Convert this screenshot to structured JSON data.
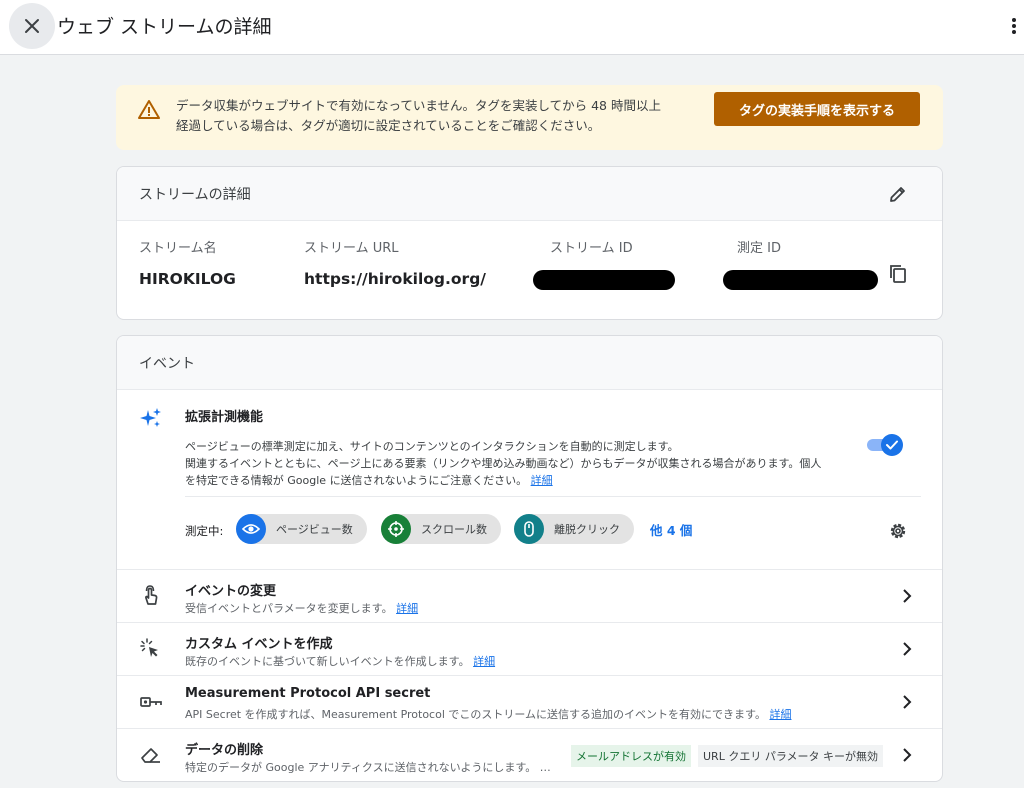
{
  "header": {
    "title": "ウェブ ストリームの詳細",
    "close_icon": "close-icon",
    "more_icon": "more-vert-icon"
  },
  "banner": {
    "icon": "warning-icon",
    "text_line1": "データ収集がウェブサイトで有効になっていません。タグを実装してから 48 時間以上",
    "text_line2": "経過している場合は、タグが適切に設定されていることをご確認ください。",
    "button_label": "タグの実装手順を表示する",
    "bg_color": "#fef7e0",
    "button_color": "#b06000"
  },
  "stream_details": {
    "title": "ストリームの詳細",
    "edit_icon": "edit-pencil-icon",
    "copy_icon": "copy-icon",
    "columns": [
      {
        "label": "ストリーム名",
        "value": "HIROKILOG"
      },
      {
        "label": "ストリーム URL",
        "value": "https://hirokilog.org/"
      },
      {
        "label": "ストリーム ID",
        "value": ""
      },
      {
        "label": "測定 ID",
        "value": ""
      }
    ]
  },
  "events": {
    "title": "イベント",
    "enhanced": {
      "icon": "sparkle-icon",
      "title": "拡張計測機能",
      "desc_line1": "ページビューの標準測定に加え、サイトのコンテンツとのインタラクションを自動的に測定します。",
      "desc_line2": "関連するイベントとともに、ページ上にある要素（リンクや埋め込み動画など）からもデータが収集される場合があります。個人",
      "desc_line3": "を特定できる情報が Google に送信されないようにご注意ください。",
      "link": "詳細",
      "toggle_on": true,
      "measuring_label": "測定中:",
      "chips": [
        {
          "label": "ページビュー数",
          "icon": "eye-icon",
          "color": "#1a73e8"
        },
        {
          "label": "スクロール数",
          "icon": "scroll-crosshair-icon",
          "color": "#188038"
        },
        {
          "label": "離脱クリック",
          "icon": "mouse-icon",
          "color": "#12808a"
        }
      ],
      "others": "他 4 個",
      "settings_icon": "gear-icon"
    },
    "rows": [
      {
        "icon": "touch-hand-icon",
        "title": "イベントの変更",
        "subtitle": "受信イベントとパラメータを変更します。",
        "link": "詳細"
      },
      {
        "icon": "click-sparkle-icon",
        "title": "カスタム イベントを作成",
        "subtitle": "既存のイベントに基づいて新しいイベントを作成します。",
        "link": "詳細"
      },
      {
        "icon": "key-icon",
        "title": "Measurement Protocol API secret",
        "subtitle": "API Secret を作成すれば、Measurement Protocol でこのストリームに送信する追加のイベントを有効にできます。",
        "link": "詳細"
      },
      {
        "icon": "eraser-icon",
        "title": "データの削除",
        "subtitle": "特定のデータが Google アナリティクスに送信されないようにします。 …",
        "badge_green": "メールアドレスが有効",
        "badge_grey": "URL クエリ パラメータ キーが無効"
      }
    ],
    "chevron_icon": "chevron-right-icon"
  }
}
